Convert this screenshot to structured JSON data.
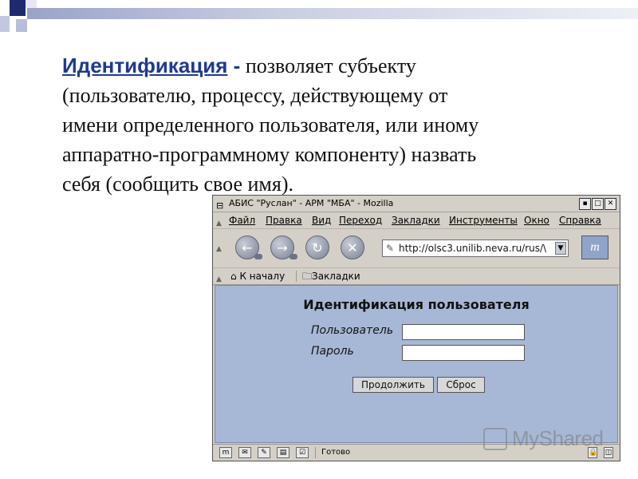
{
  "slide": {
    "term": "Идентификация",
    "dash": "-",
    "line1": " позволяет субъекту",
    "line2": "(пользователю, процессу, действующему от",
    "line3": "имени определенного пользователя, или иному",
    "line4": "аппаратно-программному компоненту) назвать",
    "line5": "себя (сообщить свое имя)."
  },
  "browser": {
    "title": "АБИС \"Руслан\" - АРМ \"МБА\" - Mozilla",
    "menu": [
      "Файл",
      "Правка",
      "Вид",
      "Переход",
      "Закладки",
      "Инструменты",
      "Окно",
      "Справка"
    ],
    "url": "http://olsc3.unilib.neva.ru/rus/\\",
    "bookmarks": [
      "К началу",
      "Закладки"
    ],
    "status_text": "Готово"
  },
  "login_page": {
    "heading": "Идентификация пользователя",
    "user_label": "Пользователь",
    "password_label": "Пароль",
    "user_value": "",
    "password_value": "",
    "continue_button": "Продолжить",
    "reset_button": "Сброс"
  },
  "watermark": "MyShared"
}
